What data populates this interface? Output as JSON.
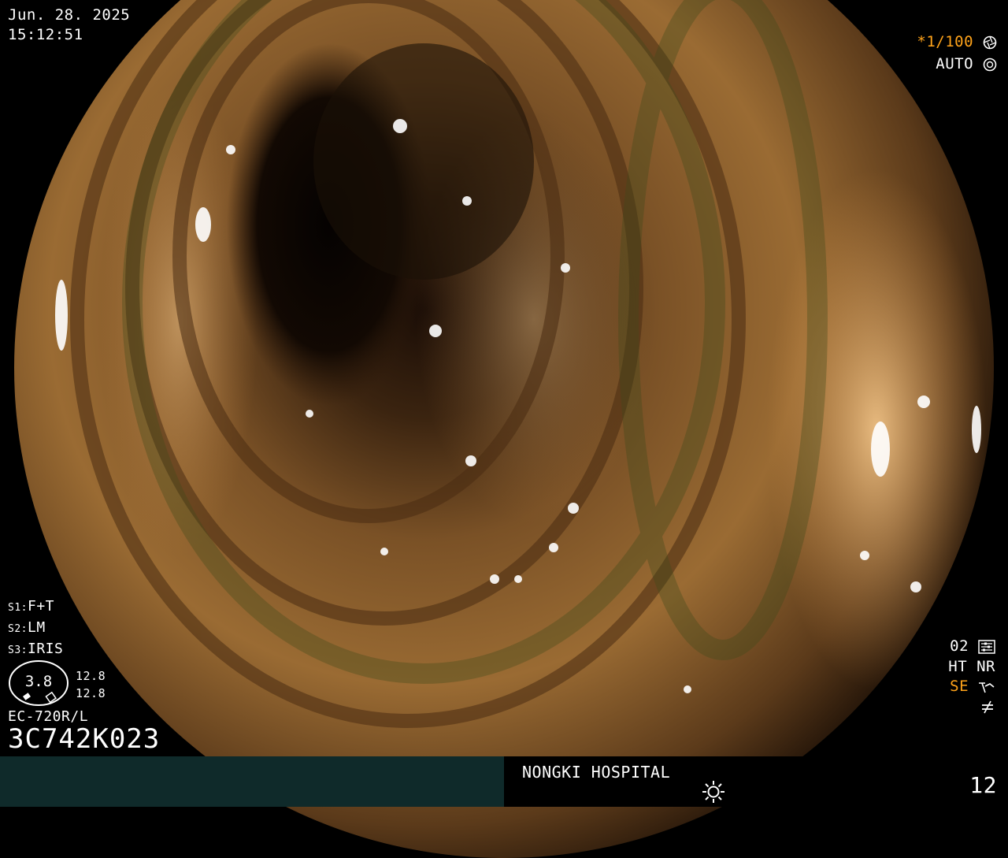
{
  "header": {
    "date": "Jun. 28. 2025",
    "time": "15:12:51"
  },
  "exposure": {
    "shutter": "*1/100",
    "mode": "AUTO"
  },
  "settings": {
    "s1_label": "S1:",
    "s1_value": "F+T",
    "s2_label": "S2:",
    "s2_value": "LM",
    "s3_label": "S3:",
    "s3_value": "IRIS"
  },
  "zoom": {
    "value": "3.8",
    "top": "12.8",
    "bottom": "12.8"
  },
  "scope": {
    "model": "EC-720R/L",
    "serial": "3C742K023"
  },
  "right_indicators": {
    "line1": "02",
    "line2": "HT NR",
    "line3": "SE"
  },
  "footer": {
    "hospital": "NONGKI HOSPITAL",
    "page_number": "12"
  },
  "icons": {
    "shutter": "aperture-icon",
    "auto": "iris-icon",
    "sun": "brightness-icon",
    "se": "enhance-icon",
    "not_equal": "not-equal-icon",
    "settings": "settings-grid-icon"
  },
  "colors": {
    "accent": "#ffa31a",
    "bar": "#0f2a2a"
  }
}
